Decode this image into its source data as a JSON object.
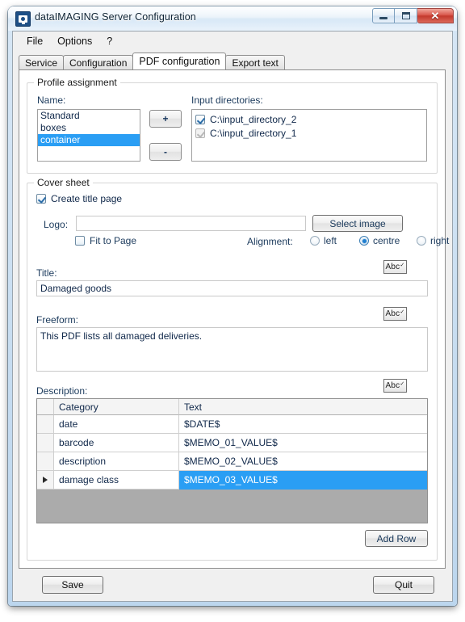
{
  "window": {
    "title": "dataIMAGING Server Configuration",
    "icon": "scanner-icon",
    "controls": {
      "minimize": "–",
      "maximize": "□",
      "close": "✕"
    }
  },
  "menu": {
    "items": [
      "File",
      "Options",
      "?"
    ]
  },
  "tabs": [
    {
      "label": "Service",
      "active": false
    },
    {
      "label": "Configuration",
      "active": false
    },
    {
      "label": "PDF configuration",
      "active": true
    },
    {
      "label": "Export text",
      "active": false
    }
  ],
  "profile_assignment": {
    "legend": "Profile assignment",
    "name_label": "Name:",
    "profiles": [
      {
        "label": "Standard",
        "selected": false
      },
      {
        "label": "boxes",
        "selected": false
      },
      {
        "label": "container",
        "selected": true
      }
    ],
    "add_button": "+",
    "remove_button": "-",
    "input_directories_label": "Input directories:",
    "input_directories": [
      {
        "label": "C:\\input_directory_2",
        "checked": true,
        "disabled": false
      },
      {
        "label": "C:\\input_directory_1",
        "checked": true,
        "disabled": true
      }
    ]
  },
  "cover_sheet": {
    "legend": "Cover sheet",
    "create_title_page": {
      "label": "Create title page",
      "checked": true
    },
    "logo_label": "Logo:",
    "logo_value": "",
    "select_image_button": "Select image",
    "fit_to_page": {
      "label": "Fit to Page",
      "checked": false
    },
    "alignment_label": "Alignment:",
    "alignment_options": [
      {
        "label": "left",
        "selected": false
      },
      {
        "label": "centre",
        "selected": true
      },
      {
        "label": "right",
        "selected": false
      }
    ],
    "spellcheck_button": "Abc",
    "title_label": "Title:",
    "title_value": "Damaged goods",
    "freeform_label": "Freeform:",
    "freeform_value": "This PDF lists all damaged deliveries.",
    "description_label": "Description:",
    "grid": {
      "columns": [
        "",
        "Category",
        "Text"
      ],
      "rows": [
        {
          "marker": "",
          "category": "date",
          "text": "$DATE$",
          "selected": false
        },
        {
          "marker": "",
          "category": "barcode",
          "text": "$MEMO_01_VALUE$",
          "selected": false
        },
        {
          "marker": "",
          "category": "description",
          "text": "$MEMO_02_VALUE$",
          "selected": false
        },
        {
          "marker": "▶",
          "category": "damage class",
          "text": "$MEMO_03_VALUE$",
          "selected": true
        }
      ]
    },
    "add_row_button": "Add Row"
  },
  "footer": {
    "save_button": "Save",
    "quit_button": "Quit"
  },
  "colors": {
    "selection_blue": "#2a9ef4",
    "label_blue": "#1b3a5c",
    "grid_empty_gray": "#ababab",
    "close_red": "#c3392d"
  }
}
